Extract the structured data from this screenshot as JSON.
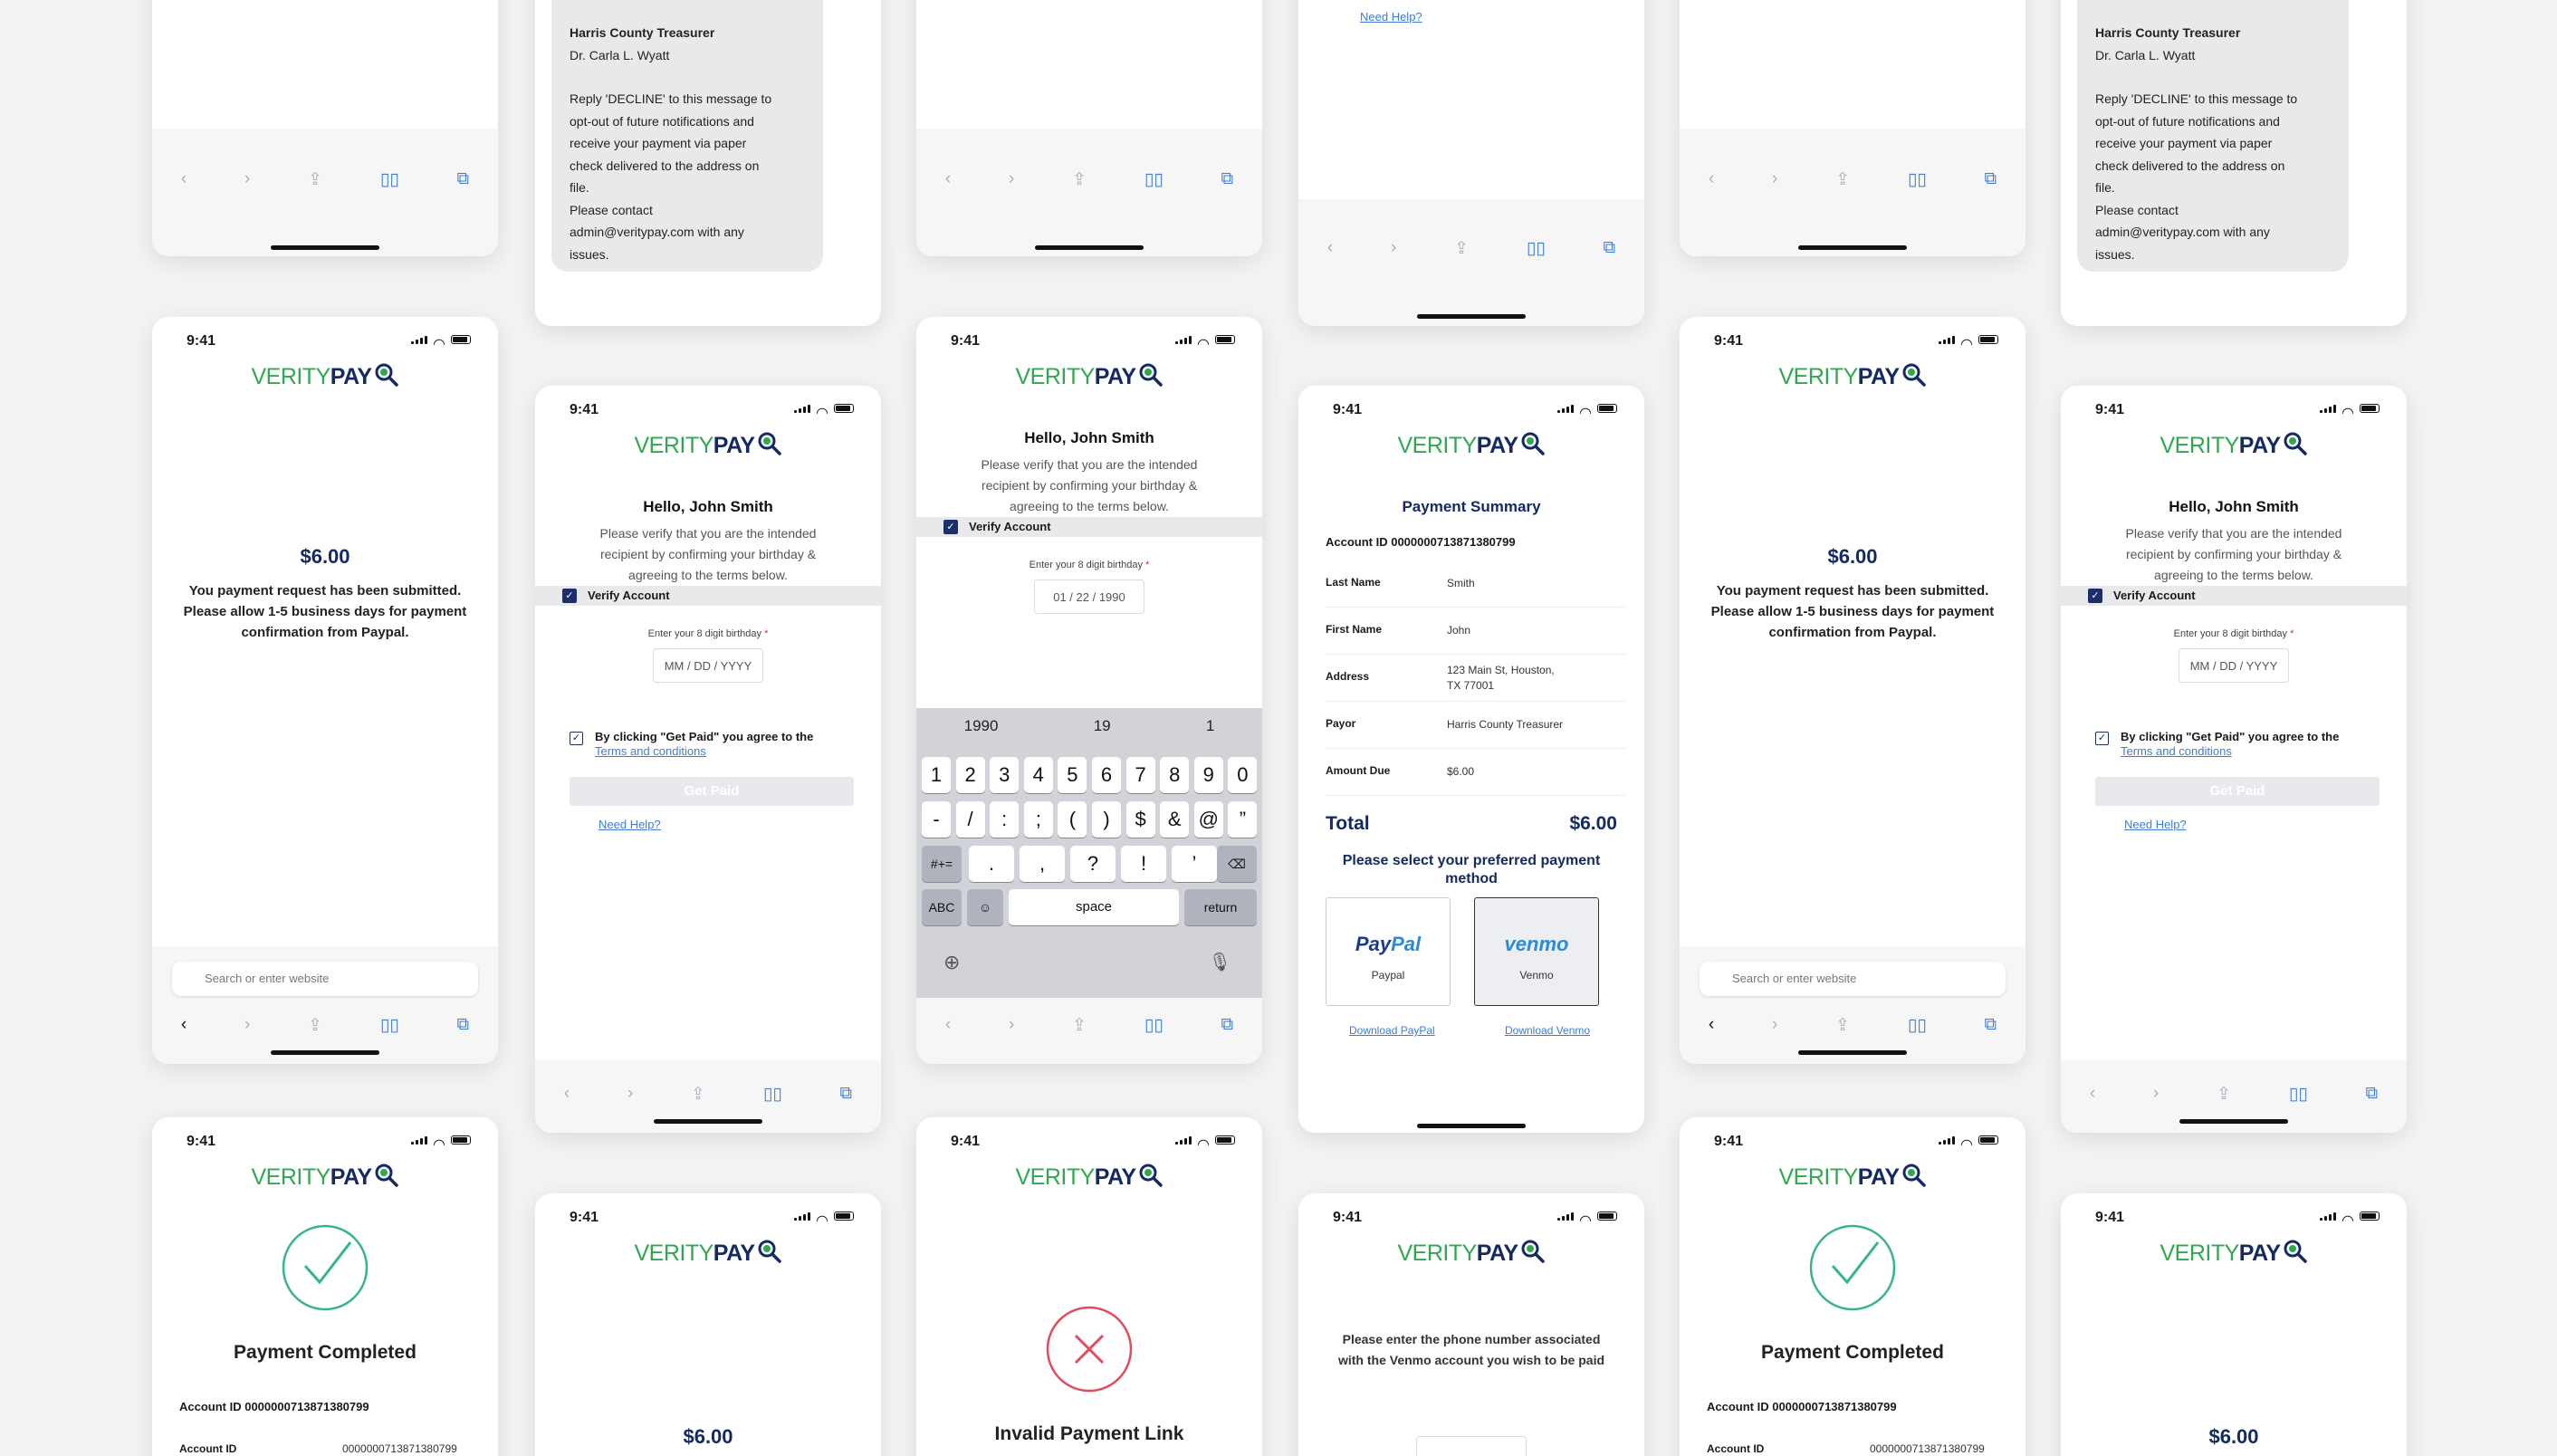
{
  "status": {
    "time": "9:41"
  },
  "brand": {
    "verity": "VERITY",
    "pay": "PAY"
  },
  "message": {
    "sender": "Harris County Treasurer",
    "name": "Dr. Carla L. Wyatt",
    "line1": "Reply 'DECLINE' to this message to",
    "line2": "opt-out of future notifications and",
    "line3": "receive your payment via paper",
    "line4": "check delivered to the address on",
    "line5": "file.",
    "line6": "Please contact",
    "line7": "admin@veritypay.com with any",
    "line8": "issues."
  },
  "submitted": {
    "amount": "$6.00",
    "msg1": "You payment request has been submitted.",
    "msg2": "Please allow 1-5 business days for payment",
    "msg3": "confirmation from Paypal."
  },
  "verify": {
    "hello": "Hello, John Smith",
    "text1": "Please verify that you are the intended",
    "text2": "recipient by confirming your birthday &",
    "text3": "agreeing to the terms below.",
    "bar": "Verify Account",
    "birthday_label": "Enter your 8 digit birthday",
    "required": "*",
    "placeholder": "MM / DD / YYYY",
    "filled": "01 / 22 / 1990",
    "agree": "By clicking \"Get Paid\" you agree to the",
    "terms": "Terms and conditions",
    "get_paid": "Get Paid",
    "need_help": "Need Help?"
  },
  "safari": {
    "search_placeholder": "Search or enter website"
  },
  "keyboard": {
    "suggestions": [
      "1990",
      "19",
      "1"
    ],
    "row1": [
      "1",
      "2",
      "3",
      "4",
      "5",
      "6",
      "7",
      "8",
      "9",
      "0"
    ],
    "row2": [
      "-",
      "/",
      ":",
      ";",
      "(",
      ")",
      "$",
      "&",
      "@",
      "”"
    ],
    "row3": [
      ".",
      ",",
      "?",
      "!",
      "’"
    ],
    "sym": "#+=",
    "abc": "ABC",
    "space": "space",
    "return": "return"
  },
  "summary": {
    "title": "Payment Summary",
    "account": "Account ID 0000000713871380799",
    "rows": [
      {
        "k": "Last Name",
        "v": "Smith"
      },
      {
        "k": "First Name",
        "v": "John"
      },
      {
        "k": "Address",
        "v": "123 Main St, Houston,",
        "v2": "TX 77001"
      },
      {
        "k": "Payor",
        "v": "Harris County Treasurer"
      },
      {
        "k": "Amount Due",
        "v": "$6.00"
      }
    ],
    "total_label": "Total",
    "total_value": "$6.00",
    "select1": "Please select your preferred payment",
    "select2": "method",
    "paypal_logo": "PayPal",
    "paypal_label": "Paypal",
    "venmo_logo": "venmo",
    "venmo_label": "Venmo",
    "download_paypal": "Download PayPal",
    "download_venmo": "Download Venmo"
  },
  "completed": {
    "title": "Payment Completed",
    "account": "Account ID 0000000713871380799",
    "row_k": "Account ID",
    "row_v": "0000000713871380799"
  },
  "invalid": {
    "title": "Invalid Payment Link"
  },
  "venmo_phone": {
    "text1": "Please enter the phone number associated",
    "text2": "with the Venmo account you wish to be paid"
  },
  "colors": {
    "green": "#2fa84f",
    "navy": "#142a63",
    "link": "#3f7bd6",
    "check": "#37b58a",
    "error": "#e24a5d"
  }
}
